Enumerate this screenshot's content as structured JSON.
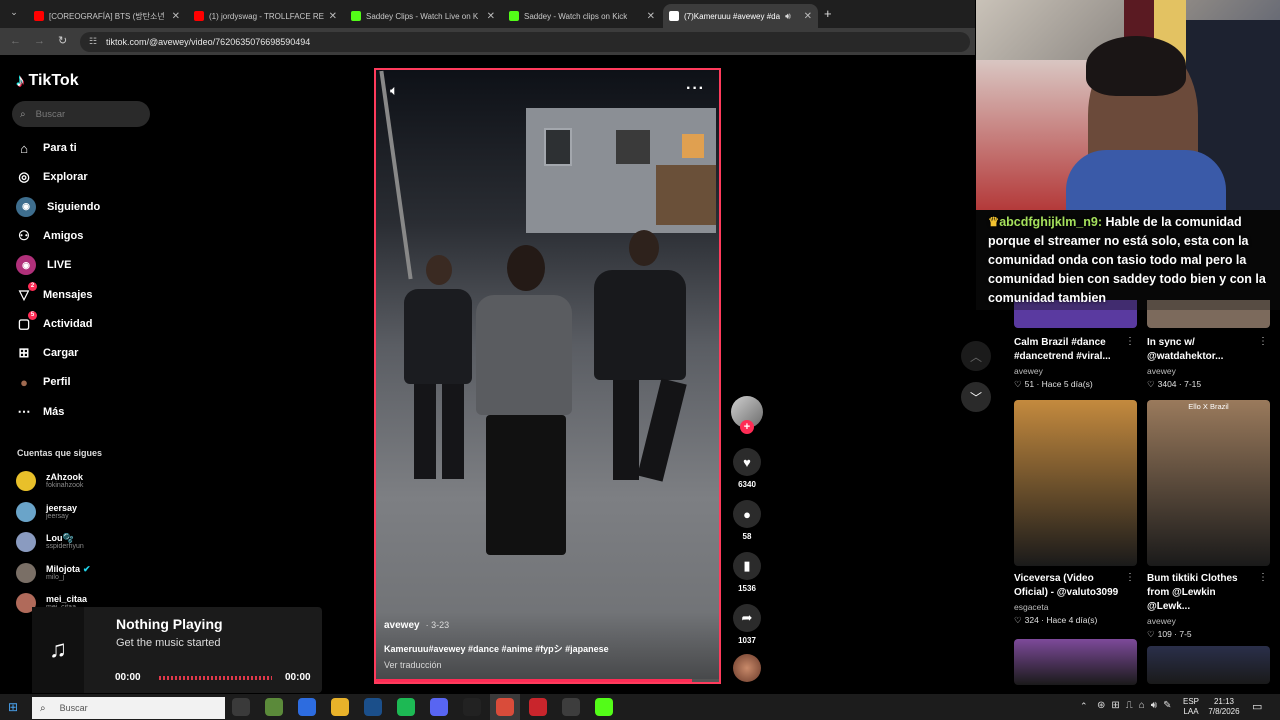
{
  "browser": {
    "tabs": [
      {
        "title": "[COREOGRAFÍA] BTS (방탄소년",
        "color": "#ff0000"
      },
      {
        "title": "(1) jordyswag - TROLLFACE REM",
        "color": "#ff0000"
      },
      {
        "title": "Saddey Clips - Watch Live on K",
        "color": "#53fc18"
      },
      {
        "title": "Saddey - Watch clips on Kick",
        "color": "#53fc18"
      },
      {
        "title": "(7)Kameruuu #avewey #da",
        "color": "#ffffff"
      }
    ],
    "url": "tiktok.com/@avewey/video/7620635076698590494",
    "icons": [
      "back-icon",
      "forward-icon",
      "reload-icon",
      "site-info-icon",
      "new-tab-icon"
    ]
  },
  "tiktok": {
    "logo": "TikTok",
    "search_placeholder": "Buscar",
    "nav": [
      {
        "label": "Para ti",
        "icon": "home-icon"
      },
      {
        "label": "Explorar",
        "icon": "compass-icon"
      },
      {
        "label": "Siguiendo",
        "icon": "following-icon"
      },
      {
        "label": "Amigos",
        "icon": "friends-icon"
      },
      {
        "label": "LIVE",
        "icon": "live-icon"
      },
      {
        "label": "Mensajes",
        "icon": "messages-icon",
        "badge": "2"
      },
      {
        "label": "Actividad",
        "icon": "activity-icon",
        "badge": "5"
      },
      {
        "label": "Cargar",
        "icon": "upload-icon"
      },
      {
        "label": "Perfil",
        "icon": "profile-icon"
      },
      {
        "label": "Más",
        "icon": "more-icon"
      }
    ],
    "following_header": "Cuentas que sigues",
    "following": [
      {
        "name": "zAhzook",
        "handle": "fokinahzook",
        "color": "#e8c02a"
      },
      {
        "name": "jeersay",
        "handle": "jeersay",
        "color": "#6aa4c9"
      },
      {
        "name": "Lou🫧",
        "handle": "sspiderhyun",
        "color": "#8a9bc0"
      },
      {
        "name": "Milojota",
        "handle": "milo_j",
        "color": "#7a6f66",
        "verified": true
      },
      {
        "name": "mei_citaa",
        "handle": "mei_citaa",
        "color": "#b06a5a"
      }
    ],
    "video": {
      "author": "avewey",
      "date": "3-23",
      "caption": "Kameruuu#avewey #dance #anime #fypシ #japanese",
      "translate": "Ver traducción",
      "likes": "6340",
      "comments": "58",
      "saves": "1536",
      "shares": "1037"
    },
    "recommendations": [
      {
        "title": "Calm Brazil #dance #dancetrend #viral...",
        "author": "avewey",
        "meta": "51 · Hace 5 día(s)",
        "thumb": "#6d4fb0"
      },
      {
        "title": "In sync w/ @watdahektor...",
        "author": "avewey",
        "meta": "3404 · 7-15",
        "thumb": "#8c6d5a"
      },
      {
        "title": "Viceversa (Video Oficial) - @valuto3099",
        "author": "esgaceta",
        "meta": "324 · Hace 4 día(s)",
        "thumb": "#c48a3e"
      },
      {
        "title": "Bum tiktiki Clothes from @Lewkin @Lewk...",
        "author": "avewey",
        "meta": "109 · 7-5",
        "thumb": "#9a7a5c",
        "overlay": "Ello X Brazil"
      },
      {
        "title": "",
        "author": "",
        "meta": "",
        "thumb": "#7d4a9a"
      },
      {
        "title": "",
        "author": "",
        "meta": "",
        "thumb": "#2a2f4a"
      }
    ]
  },
  "stream_chat": {
    "username": "abcdfghijklm_n9:",
    "message": "Hable de la comunidad porque el streamer no está solo, esta con la comunidad onda con tasio todo mal pero la comunidad bien con saddey todo bien y con la comunidad tambien",
    "username_color": "#a5e05c"
  },
  "music_widget": {
    "title": "Nothing Playing",
    "subtitle": "Get the music started",
    "time_start": "00:00",
    "time_end": "00:00"
  },
  "taskbar": {
    "search_placeholder": "Buscar",
    "language": "ESP",
    "layout": "LAA",
    "time": "21:13",
    "date": "7/8/2026",
    "apps": [
      {
        "name": "task-view-icon",
        "color": "#3a3a3a"
      },
      {
        "name": "files-icon",
        "color": "#5b8a3a"
      },
      {
        "name": "mail-icon",
        "color": "#2d6cdf"
      },
      {
        "name": "chrome-icon",
        "color": "#e8b22a"
      },
      {
        "name": "steam-icon",
        "color": "#1b4f8a"
      },
      {
        "name": "spotify-icon",
        "color": "#1db954"
      },
      {
        "name": "discord-icon",
        "color": "#5865f2"
      },
      {
        "name": "capcut-icon",
        "color": "#222222"
      },
      {
        "name": "chrome-active-icon",
        "color": "#d94c3a"
      },
      {
        "name": "recorder-icon",
        "color": "#c9252c"
      },
      {
        "name": "obs-icon",
        "color": "#3d3d3d"
      },
      {
        "name": "kick-icon",
        "color": "#53fc18"
      }
    ]
  }
}
